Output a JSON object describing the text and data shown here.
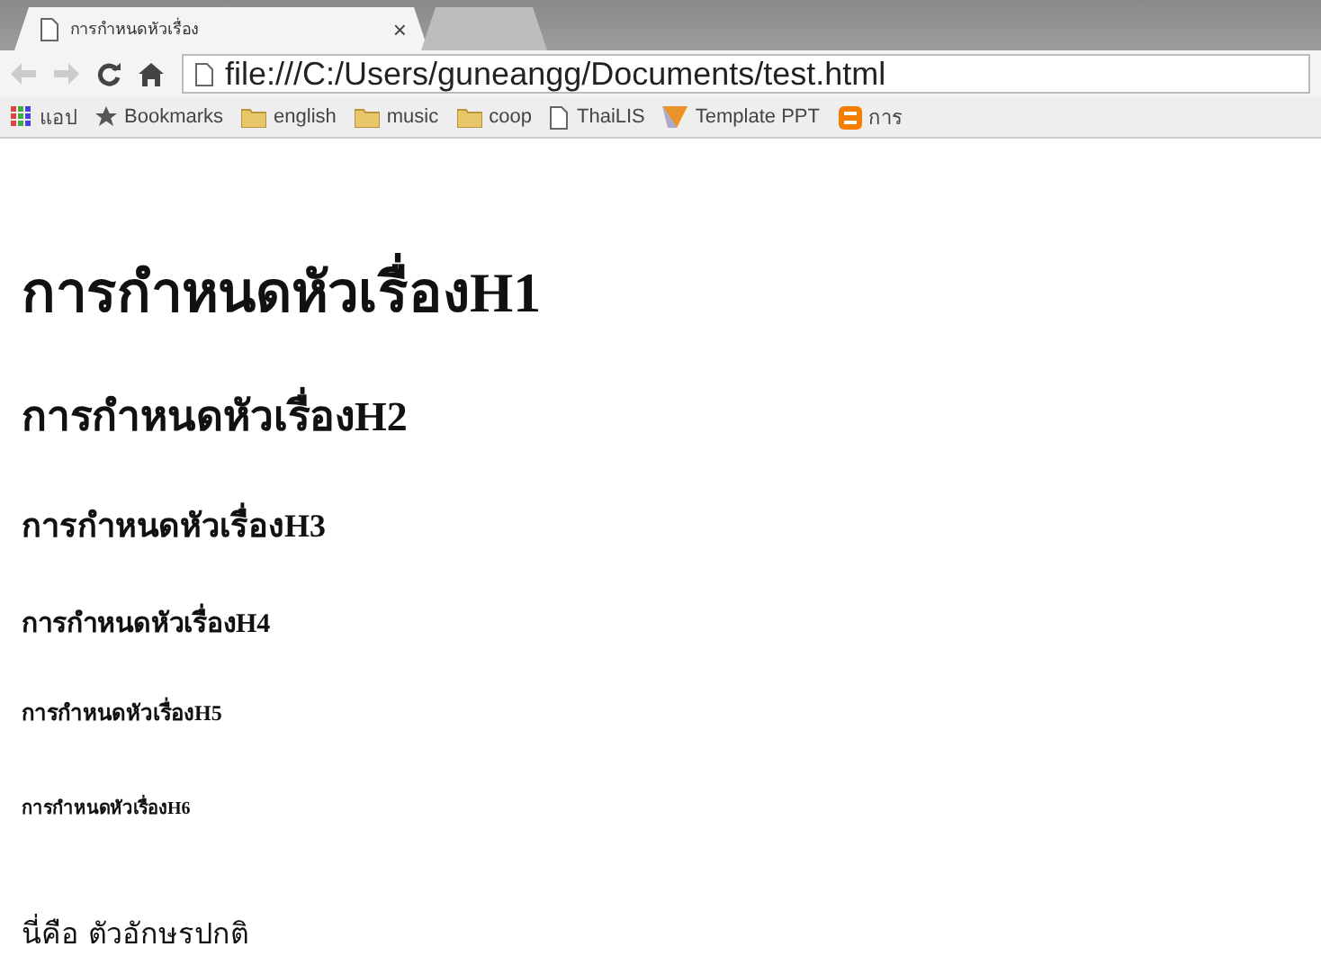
{
  "tabs": [
    {
      "title": "การกำหนดหัวเรื่อง",
      "selected": true,
      "close": "×"
    },
    {
      "selected": false
    }
  ],
  "toolbar": {
    "address": "file:///C:/Users/guneangg/Documents/test.html"
  },
  "bookmarks": [
    {
      "kind": "apps",
      "label": "แอป"
    },
    {
      "kind": "star",
      "label": "Bookmarks"
    },
    {
      "kind": "folder",
      "label": "english"
    },
    {
      "kind": "folder",
      "label": "music"
    },
    {
      "kind": "folder",
      "label": "coop"
    },
    {
      "kind": "page",
      "label": "ThaiLIS"
    },
    {
      "kind": "ppt",
      "label": "Template PPT"
    },
    {
      "kind": "blog",
      "label": "การ"
    }
  ],
  "content": {
    "headings": [
      {
        "kind": "h1",
        "text": "การกำหนดหัวเรื่องH1"
      },
      {
        "kind": "h2",
        "text": "การกำหนดหัวเรื่องH2"
      },
      {
        "kind": "h3",
        "text": "การกำหนดหัวเรื่องH3"
      },
      {
        "kind": "h4",
        "text": "การกำหนดหัวเรื่องH4"
      },
      {
        "kind": "h5",
        "text": "การกำหนดหัวเรื่องH5"
      },
      {
        "kind": "h6",
        "text": "การกำหนดหัวเรื่องH6"
      }
    ],
    "paragraph": "นี่คือ ตัวอักษรปกติ"
  }
}
